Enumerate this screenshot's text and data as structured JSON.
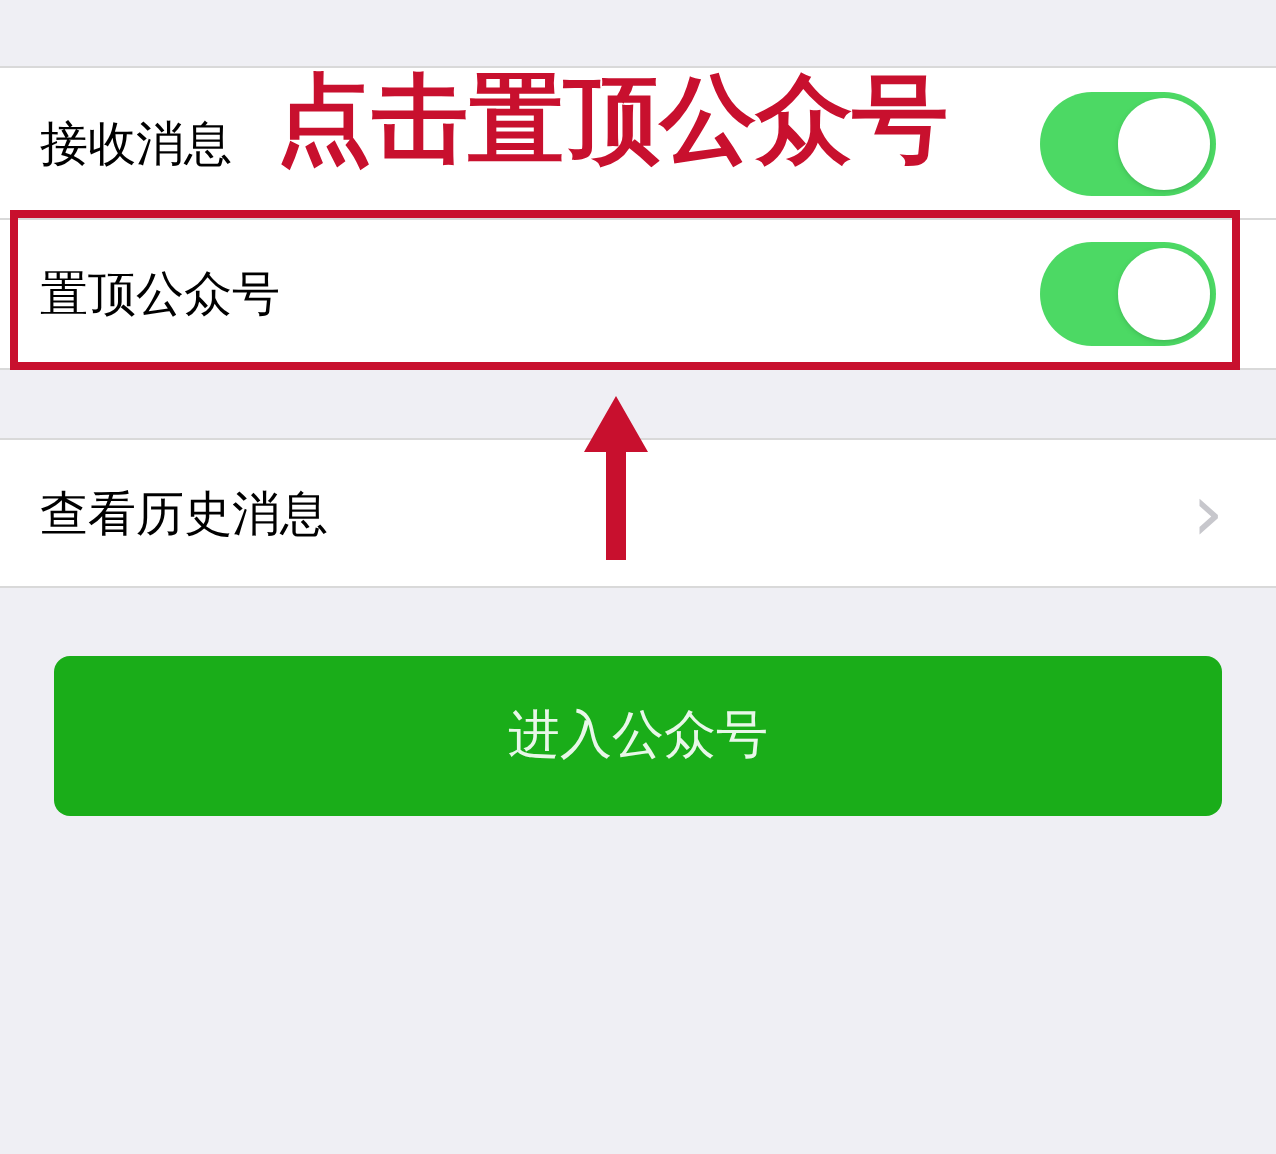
{
  "settings_group": [
    {
      "label": "接收消息",
      "on": true,
      "highlighted": false
    },
    {
      "label": "置顶公众号",
      "on": true,
      "highlighted": true
    }
  ],
  "history_row": {
    "label": "查看历史消息",
    "chevron": "›"
  },
  "enter_button": {
    "label": "进入公众号"
  },
  "annotation": {
    "text": "点击置顶公众号"
  }
}
